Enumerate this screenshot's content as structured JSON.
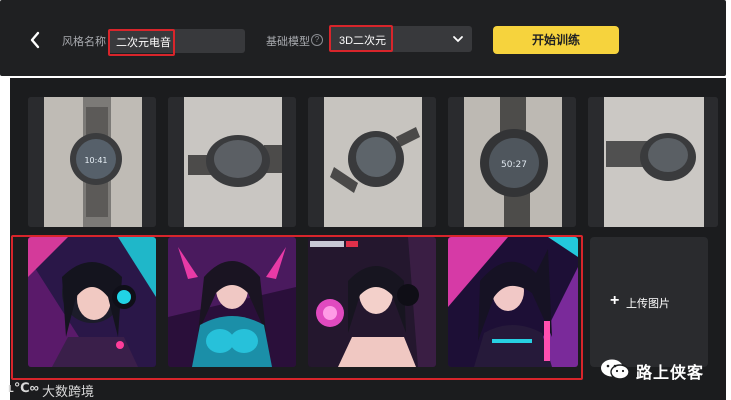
{
  "toolbar": {
    "style_name_label": "风格名称",
    "style_name_value": "二次元电音",
    "base_model_label": "基础模型",
    "help_glyph": "?",
    "base_model_value": "3D二次元",
    "start_training_label": "开始训练"
  },
  "training_images": [
    {
      "subject": "watch-on-table"
    },
    {
      "subject": "watch-side-view"
    },
    {
      "subject": "watch-tilted"
    },
    {
      "subject": "watch-closeup"
    },
    {
      "subject": "watch-strap"
    }
  ],
  "generated_images": [
    {
      "subject": "anime-girl-headphones-pink"
    },
    {
      "subject": "anime-girl-armor"
    },
    {
      "subject": "anime-girl-orb"
    },
    {
      "subject": "anime-girl-neon-ponytail"
    }
  ],
  "upload": {
    "plus": "+",
    "label": "上传图片"
  },
  "watermark": {
    "author": "路上侠客",
    "brand_logo": "ʟ℃∞",
    "brand": "大数跨境"
  },
  "colors": {
    "accent_yellow": "#f6d33d",
    "highlight_red": "#d8252b",
    "toolbar_bg": "#1f2022",
    "content_bg": "#1b1c1e"
  }
}
